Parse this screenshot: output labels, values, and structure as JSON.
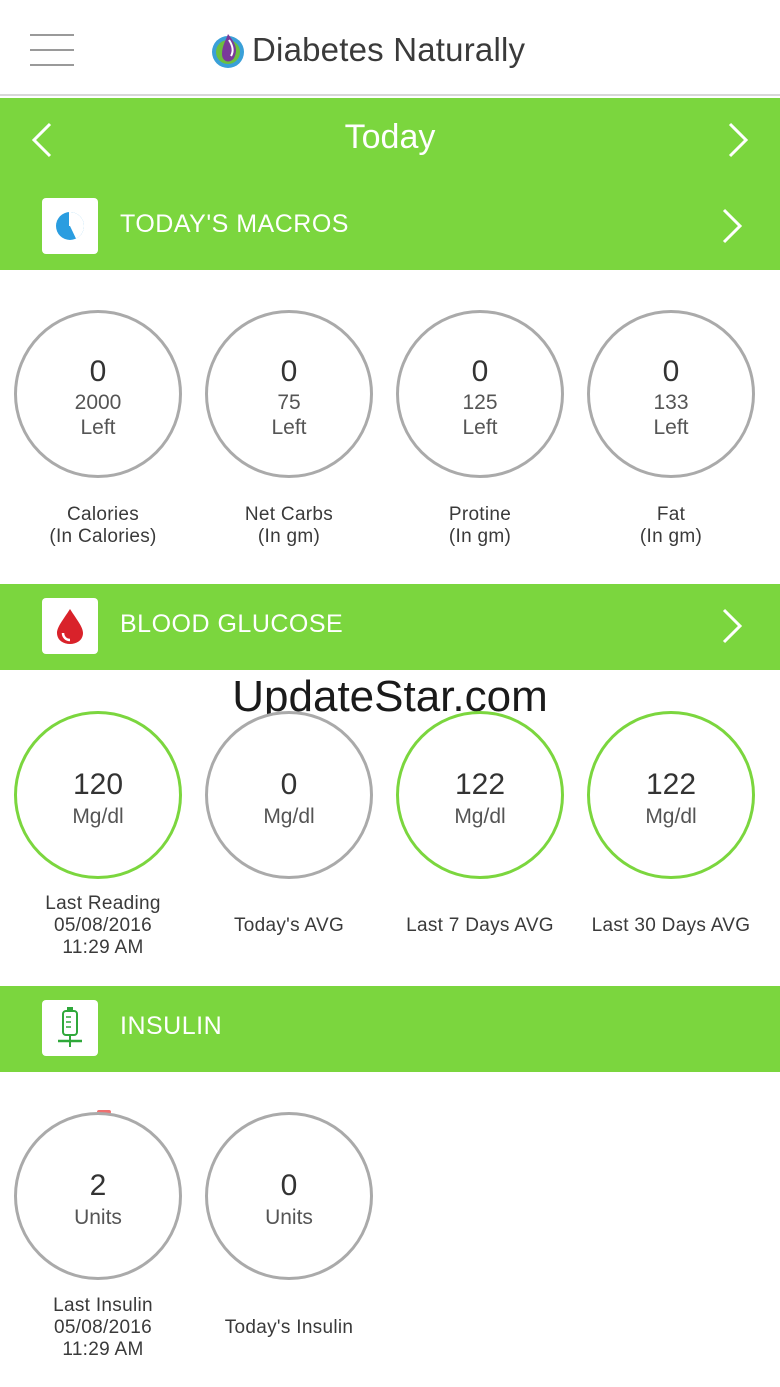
{
  "app": {
    "title": "Diabetes Naturally",
    "accent_color": "#7bd63e",
    "menu_icon": "hamburger-menu-icon",
    "logo_icon": "droplet-leaf-logo"
  },
  "day_nav": {
    "title": "Today",
    "prev_icon": "chevron-left-icon",
    "next_icon": "chevron-right-icon"
  },
  "macros": {
    "title": "TODAY'S MACROS",
    "icon": "pie-chart-icon",
    "items": [
      {
        "value": "0",
        "remaining": "2000",
        "remaining_label": "Left",
        "label": "Calories",
        "unit": "(In Calories)"
      },
      {
        "value": "0",
        "remaining": "75",
        "remaining_label": "Left",
        "label": "Net Carbs",
        "unit": "(In gm)"
      },
      {
        "value": "0",
        "remaining": "125",
        "remaining_label": "Left",
        "label": "Protine",
        "unit": "(In gm)"
      },
      {
        "value": "0",
        "remaining": "133",
        "remaining_label": "Left",
        "label": "Fat",
        "unit": "(In gm)"
      }
    ]
  },
  "glucose": {
    "title": "BLOOD GLUCOSE",
    "icon": "blood-drop-icon",
    "items": [
      {
        "value": "120",
        "unit": "Mg/dl",
        "label": "Last Reading",
        "date": "05/08/2016",
        "time": "11:29 AM"
      },
      {
        "value": "0",
        "unit": "Mg/dl",
        "label": "Today's AVG"
      },
      {
        "value": "122",
        "unit": "Mg/dl",
        "label": "Last 7 Days AVG"
      },
      {
        "value": "122",
        "unit": "Mg/dl",
        "label": "Last 30 Days AVG"
      }
    ]
  },
  "insulin": {
    "title": "INSULIN",
    "icon": "syringe-icon",
    "items": [
      {
        "value": "2",
        "unit": "Units",
        "label": "Last Insulin",
        "date": "05/08/2016",
        "time": "11:29 AM"
      },
      {
        "value": "0",
        "unit": "Units",
        "label": "Today's Insulin"
      }
    ]
  },
  "watermark": "UpdateStar.com"
}
